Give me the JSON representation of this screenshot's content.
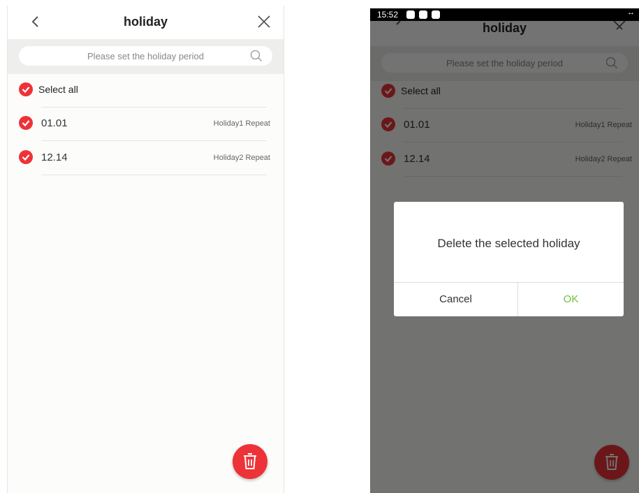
{
  "colors": {
    "accent_red": "#ee3338",
    "ok_green": "#6fc13b",
    "search_bg": "#eeeeec"
  },
  "header": {
    "title": "holiday",
    "back_icon": "chevron-left-icon",
    "close_icon": "close-icon"
  },
  "search": {
    "placeholder": "Please set the holiday period",
    "icon": "search-icon"
  },
  "select_all": {
    "label": "Select all",
    "checked": true
  },
  "holidays": [
    {
      "date": "01.01",
      "info": "Holiday1 Repeat",
      "checked": true
    },
    {
      "date": "12.14",
      "info": "Holiday2 Repeat",
      "checked": true
    }
  ],
  "delete_button": {
    "icon": "trash-icon"
  },
  "status_bar": {
    "time": "15:52"
  },
  "dialog": {
    "message": "Delete the selected holiday",
    "cancel_label": "Cancel",
    "ok_label": "OK"
  }
}
